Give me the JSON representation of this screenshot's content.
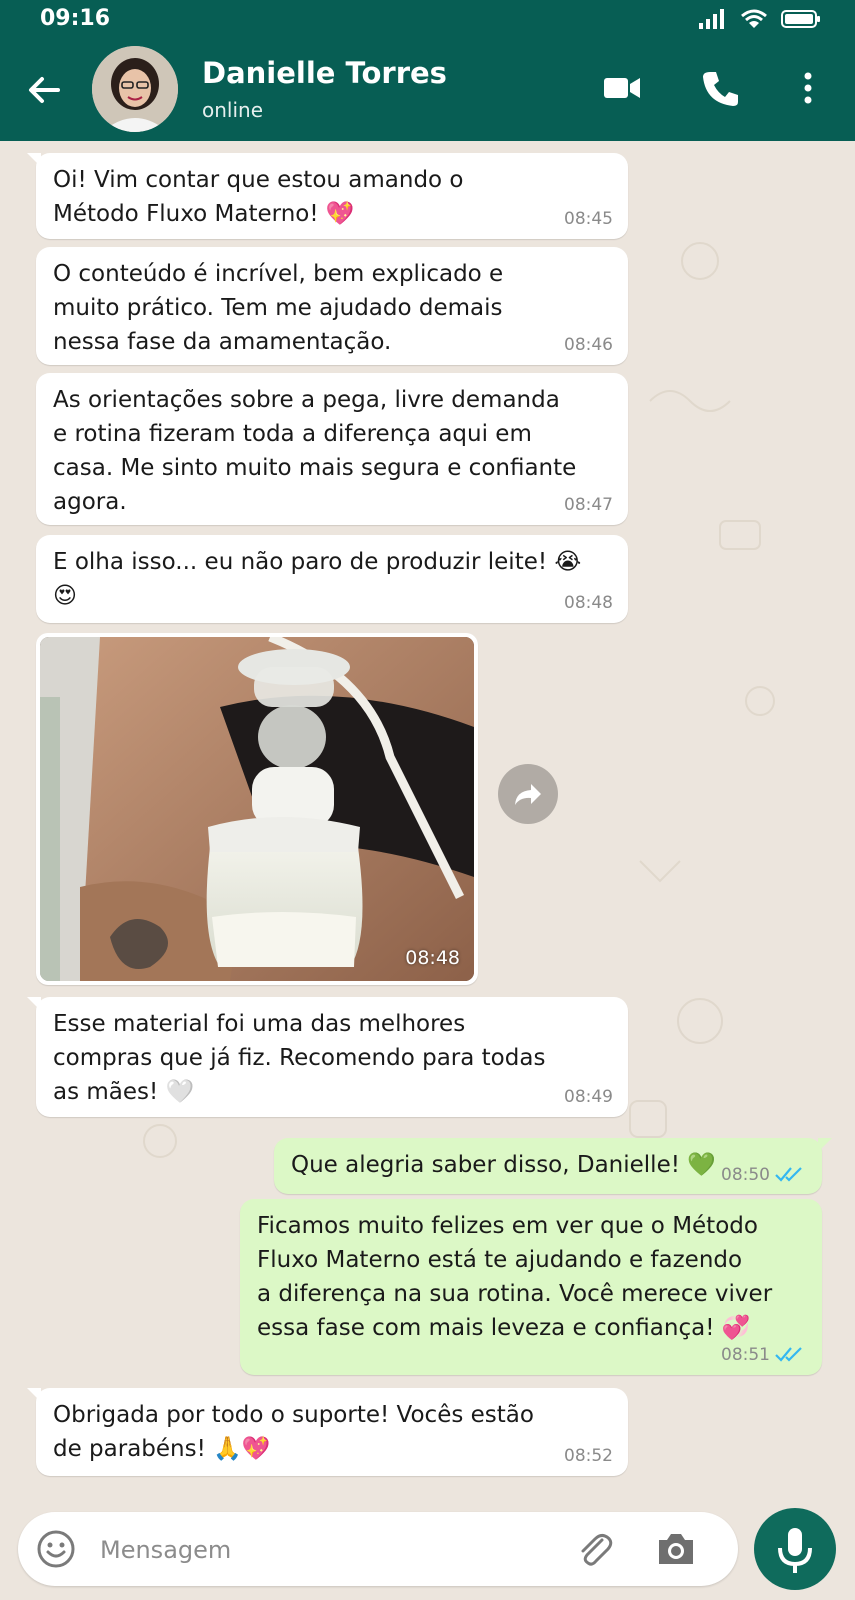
{
  "status": {
    "time": "09:16"
  },
  "header": {
    "name": "Danielle Torres",
    "status": "online"
  },
  "messages": [
    {
      "dir": "in",
      "text": "Oi! Vim contar que estou amando o\nMétodo Fluxo Materno! 💖",
      "time": "08:45"
    },
    {
      "dir": "in",
      "text": "O conteúdo é incrível, bem explicado e\nmuito prático. Tem me ajudado demais\nnessa fase da amamentação.",
      "time": "08:46"
    },
    {
      "dir": "in",
      "text": "As orientações sobre a pega, livre demanda\ne rotina fizeram toda a diferença aqui em\ncasa. Me sinto muito mais segura e confiante\nagora.",
      "time": "08:47"
    },
    {
      "dir": "in",
      "text": "E olha isso... eu não paro de produzir leite! 😭\n😍",
      "time": "08:48"
    },
    {
      "dir": "in",
      "type": "image",
      "time": "08:48"
    },
    {
      "dir": "in",
      "text": "Esse material foi uma das melhores\ncompras que já fiz. Recomendo para todas\nas mães! 🤍",
      "time": "08:49"
    },
    {
      "dir": "out",
      "text": "Que alegria saber disso, Danielle! 💚",
      "time": "08:50",
      "read": true
    },
    {
      "dir": "out",
      "text": "Ficamos muito felizes em ver que o Método\nFluxo Materno está te ajudando e fazendo\na diferença na sua rotina. Você merece viver\nessa fase com mais leveza e confiança! 💞",
      "time": "08:51",
      "read": true
    },
    {
      "dir": "in",
      "text": "Obrigada por todo o suporte! Vocês estão\nde parabéns! 🙏💖",
      "time": "08:52"
    }
  ],
  "composer": {
    "placeholder": "Mensagem"
  },
  "colors": {
    "header": "#075e54",
    "chat_bg": "#ece5dd",
    "outgoing": "#dcf8c6",
    "incoming": "#ffffff",
    "ticks": "#34b7f1",
    "mic": "#0f6b5c"
  },
  "icons": [
    "back-arrow-icon",
    "video-call-icon",
    "phone-icon",
    "more-vert-icon",
    "forward-icon",
    "emoji-icon",
    "attach-icon",
    "camera-icon",
    "mic-icon",
    "read-ticks-icon"
  ]
}
